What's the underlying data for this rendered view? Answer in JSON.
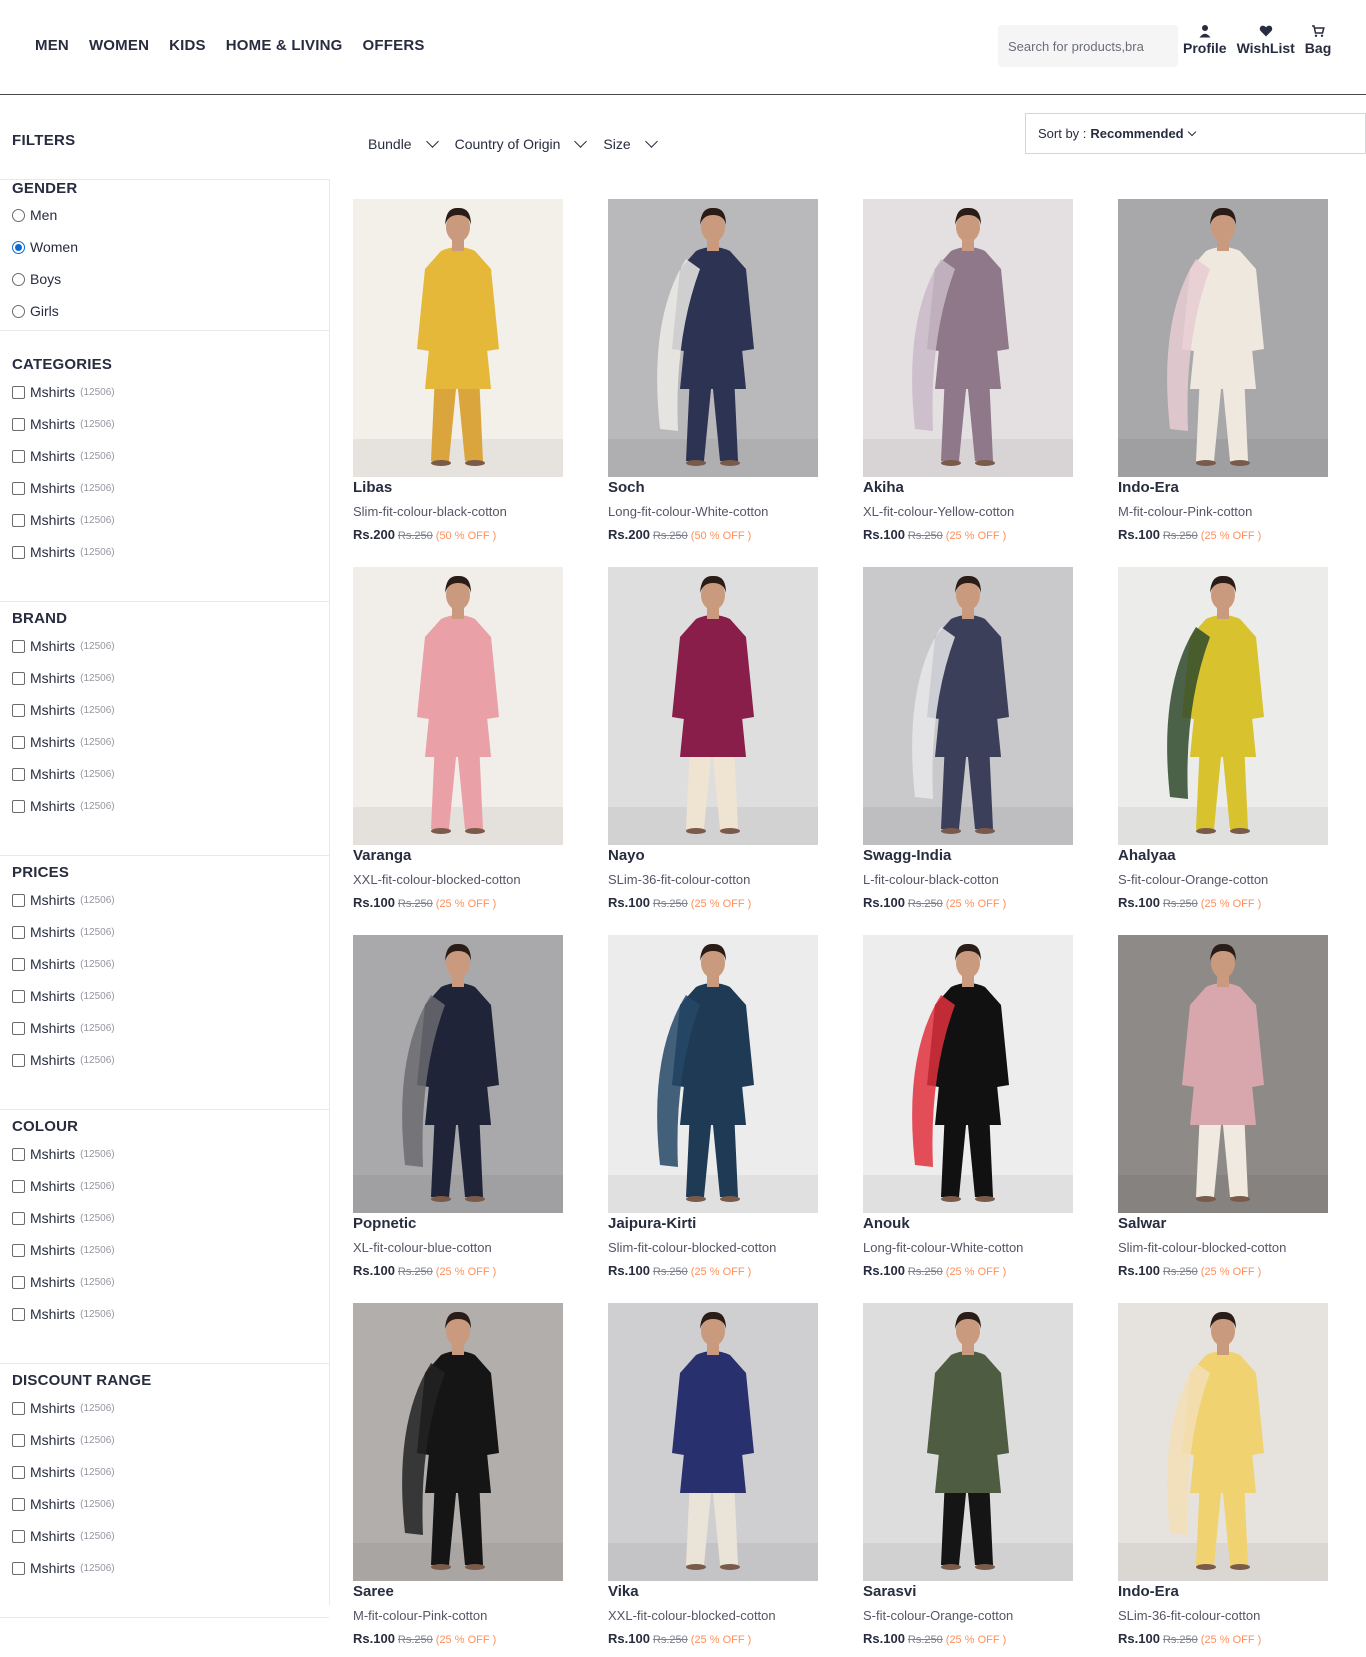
{
  "nav": {
    "items": [
      "MEN",
      "WOMEN",
      "KIDS",
      "HOME & LIVING",
      "OFFERS"
    ]
  },
  "search": {
    "placeholder": "Search for products,bra"
  },
  "header_actions": {
    "profile": "Profile",
    "wishlist": "WishList",
    "bag": "Bag"
  },
  "filters": {
    "title": "FILTERS",
    "chips": [
      "Bundle",
      "Country of Origin",
      "Size"
    ],
    "sort_prefix": "Sort by :",
    "sort_value": "Recommended"
  },
  "sidebar": {
    "gender": {
      "title": "GENDER",
      "options": [
        "Men",
        "Women",
        "Boys",
        "Girls"
      ],
      "selected": "Women"
    },
    "sections": [
      {
        "title": "CATEGORIES",
        "options": [
          {
            "label": "Mshirts",
            "count": "(12506)"
          },
          {
            "label": "Mshirts",
            "count": "(12506)"
          },
          {
            "label": "Mshirts",
            "count": "(12506)"
          },
          {
            "label": "Mshirts",
            "count": "(12506)"
          },
          {
            "label": "Mshirts",
            "count": "(12506)"
          },
          {
            "label": "Mshirts",
            "count": "(12506)"
          }
        ]
      },
      {
        "title": "BRAND",
        "options": [
          {
            "label": "Mshirts",
            "count": "(12506)"
          },
          {
            "label": "Mshirts",
            "count": "(12506)"
          },
          {
            "label": "Mshirts",
            "count": "(12506)"
          },
          {
            "label": "Mshirts",
            "count": "(12506)"
          },
          {
            "label": "Mshirts",
            "count": "(12506)"
          },
          {
            "label": "Mshirts",
            "count": "(12506)"
          }
        ]
      },
      {
        "title": "PRICES",
        "options": [
          {
            "label": "Mshirts",
            "count": "(12506)"
          },
          {
            "label": "Mshirts",
            "count": "(12506)"
          },
          {
            "label": "Mshirts",
            "count": "(12506)"
          },
          {
            "label": "Mshirts",
            "count": "(12506)"
          },
          {
            "label": "Mshirts",
            "count": "(12506)"
          },
          {
            "label": "Mshirts",
            "count": "(12506)"
          }
        ]
      },
      {
        "title": "COLOUR",
        "options": [
          {
            "label": "Mshirts",
            "count": "(12506)"
          },
          {
            "label": "Mshirts",
            "count": "(12506)"
          },
          {
            "label": "Mshirts",
            "count": "(12506)"
          },
          {
            "label": "Mshirts",
            "count": "(12506)"
          },
          {
            "label": "Mshirts",
            "count": "(12506)"
          },
          {
            "label": "Mshirts",
            "count": "(12506)"
          }
        ]
      },
      {
        "title": "DISCOUNT RANGE",
        "options": [
          {
            "label": "Mshirts",
            "count": "(12506)"
          },
          {
            "label": "Mshirts",
            "count": "(12506)"
          },
          {
            "label": "Mshirts",
            "count": "(12506)"
          },
          {
            "label": "Mshirts",
            "count": "(12506)"
          },
          {
            "label": "Mshirts",
            "count": "(12506)"
          },
          {
            "label": "Mshirts",
            "count": "(12506)"
          }
        ]
      }
    ]
  },
  "products": [
    {
      "brand": "Libas",
      "desc": "Slim-fit-colour-black-cotton",
      "price": "Rs.200",
      "mrp": "Rs.250",
      "off": "(50 % OFF )",
      "bg": "#f3efe9",
      "outfit": "#e6b83a",
      "bottom": "#d9a53c",
      "drape": ""
    },
    {
      "brand": "Soch",
      "desc": "Long-fit-colour-White-cotton",
      "price": "Rs.200",
      "mrp": "Rs.250",
      "off": "(50 % OFF )",
      "bg": "#b9b9bb",
      "outfit": "#2d3352",
      "bottom": "#2d3352",
      "drape": "#ecebe6"
    },
    {
      "brand": "Akiha",
      "desc": "XL-fit-colour-Yellow-cotton",
      "price": "Rs.100",
      "mrp": "Rs.250",
      "off": "(25 % OFF )",
      "bg": "#e4e0e2",
      "outfit": "#8e7889",
      "bottom": "#8e7889",
      "drape": "#c9b8c7"
    },
    {
      "brand": "Indo-Era",
      "desc": "M-fit-colour-Pink-cotton",
      "price": "Rs.100",
      "mrp": "Rs.250",
      "off": "(25 % OFF )",
      "bg": "#a8a8aa",
      "outfit": "#efe8de",
      "bottom": "#efe8de",
      "drape": "#e7cbd3"
    },
    {
      "brand": "Varanga",
      "desc": "XXL-fit-colour-blocked-cotton",
      "price": "Rs.100",
      "mrp": "Rs.250",
      "off": "(25 % OFF )",
      "bg": "#f1ede8",
      "outfit": "#e9a0a6",
      "bottom": "#e9a0a6",
      "drape": ""
    },
    {
      "brand": "Nayo",
      "desc": "SLim-36-fit-colour-cotton",
      "price": "Rs.100",
      "mrp": "Rs.250",
      "off": "(25 % OFF )",
      "bg": "#dedede",
      "outfit": "#8a1e4b",
      "bottom": "#efe3d1",
      "drape": ""
    },
    {
      "brand": "Swagg-India",
      "desc": "L-fit-colour-black-cotton",
      "price": "Rs.100",
      "mrp": "Rs.250",
      "off": "(25 % OFF )",
      "bg": "#c9c9cb",
      "outfit": "#3b3f5a",
      "bottom": "#3b3f5a",
      "drape": "#e8e8ea"
    },
    {
      "brand": "Ahalyaa",
      "desc": "S-fit-colour-Orange-cotton",
      "price": "Rs.100",
      "mrp": "Rs.250",
      "off": "(25 % OFF )",
      "bg": "#ececea",
      "outfit": "#d8c22e",
      "bottom": "#d8c22e",
      "drape": "#2f4a2c"
    },
    {
      "brand": "Popnetic",
      "desc": "XL-fit-colour-blue-cotton",
      "price": "Rs.100",
      "mrp": "Rs.250",
      "off": "(25 % OFF )",
      "bg": "#a9a9ab",
      "outfit": "#1f2439",
      "bottom": "#1f2439",
      "drape": "#6b6b70"
    },
    {
      "brand": "Jaipura-Kirti",
      "desc": "Slim-fit-colour-blocked-cotton",
      "price": "Rs.100",
      "mrp": "Rs.250",
      "off": "(25 % OFF )",
      "bg": "#ececec",
      "outfit": "#1e3a55",
      "bottom": "#1e3a55",
      "drape": "#264866"
    },
    {
      "brand": "Anouk",
      "desc": "Long-fit-colour-White-cotton",
      "price": "Rs.100",
      "mrp": "Rs.250",
      "off": "(25 % OFF )",
      "bg": "#ededed",
      "outfit": "#111111",
      "bottom": "#111111",
      "drape": "#e0303d"
    },
    {
      "brand": "Salwar",
      "desc": "Slim-fit-colour-blocked-cotton",
      "price": "Rs.100",
      "mrp": "Rs.250",
      "off": "(25 % OFF )",
      "bg": "#8d8a87",
      "outfit": "#d7a7ad",
      "bottom": "#efe9df",
      "drape": ""
    },
    {
      "brand": "Saree",
      "desc": "M-fit-colour-Pink-cotton",
      "price": "Rs.100",
      "mrp": "Rs.250",
      "off": "(25 % OFF )",
      "bg": "#b1aeab",
      "outfit": "#151515",
      "bottom": "#151515",
      "drape": "#222222"
    },
    {
      "brand": "Vika",
      "desc": "XXL-fit-colour-blocked-cotton",
      "price": "Rs.100",
      "mrp": "Rs.250",
      "off": "(25 % OFF )",
      "bg": "#cfcfd1",
      "outfit": "#28306e",
      "bottom": "#eae3d8",
      "drape": ""
    },
    {
      "brand": "Sarasvi",
      "desc": "S-fit-colour-Orange-cotton",
      "price": "Rs.100",
      "mrp": "Rs.250",
      "off": "(25 % OFF )",
      "bg": "#dddddd",
      "outfit": "#4e5c42",
      "bottom": "#151515",
      "drape": ""
    },
    {
      "brand": "Indo-Era",
      "desc": "SLim-36-fit-colour-cotton",
      "price": "Rs.100",
      "mrp": "Rs.250",
      "off": "(25 % OFF )",
      "bg": "#e6e3df",
      "outfit": "#f0d270",
      "bottom": "#f0d270",
      "drape": "#f3dfb6"
    }
  ]
}
